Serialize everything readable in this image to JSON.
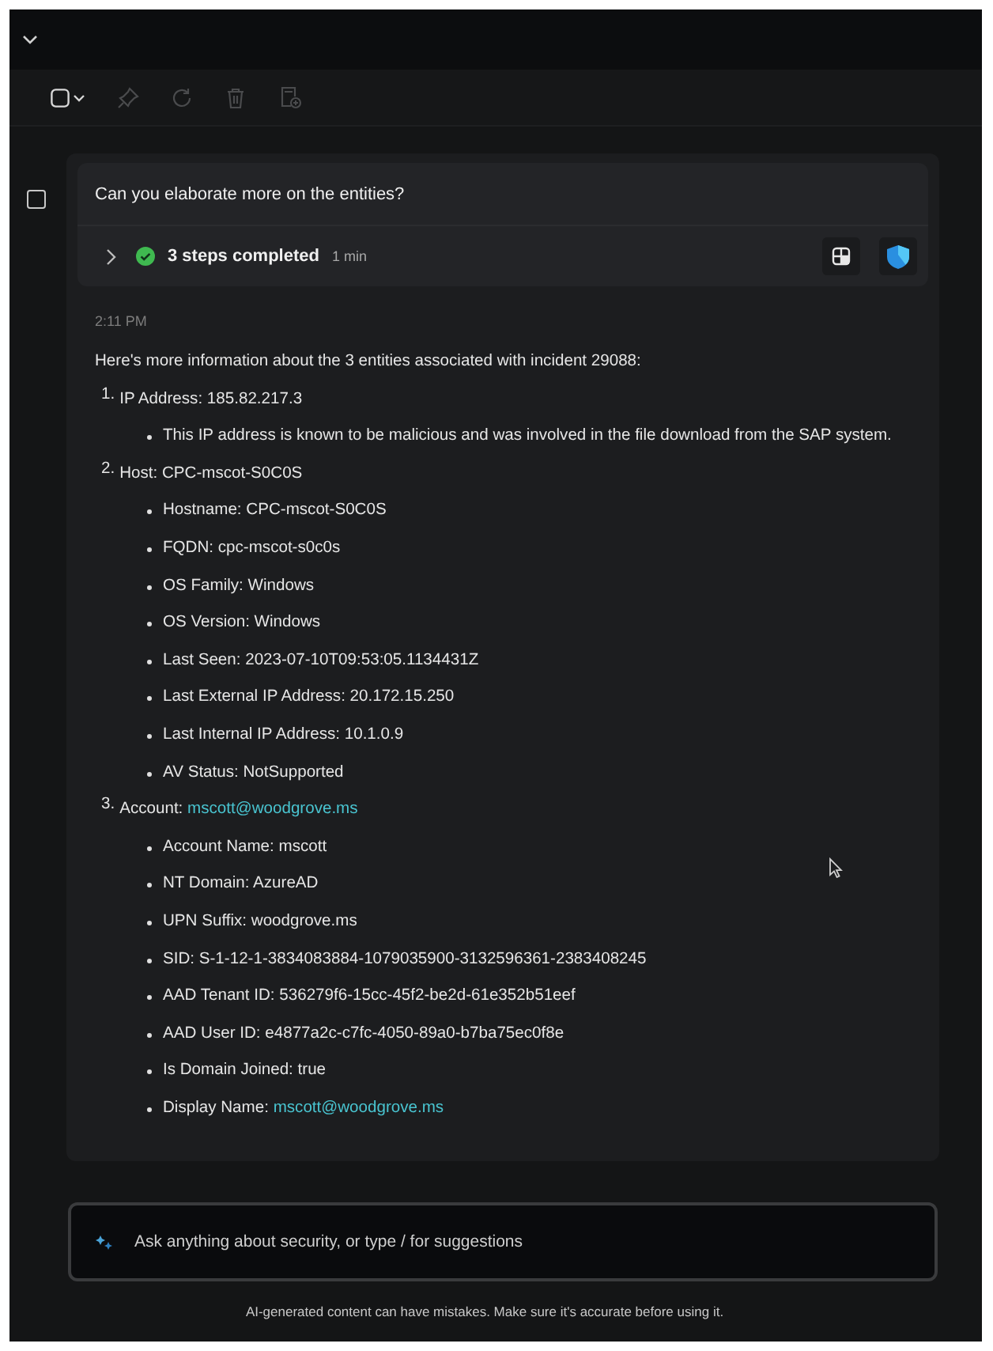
{
  "toolbar": [
    {
      "kind": "select",
      "disabled": false
    },
    {
      "kind": "pin",
      "disabled": true
    },
    {
      "kind": "refresh",
      "disabled": true
    },
    {
      "kind": "delete",
      "disabled": true
    },
    {
      "kind": "add-note",
      "disabled": true
    }
  ],
  "prompt": {
    "selected": false,
    "question": "Can you elaborate more on the entities?",
    "steps": {
      "expanded": false,
      "label": "3 steps completed",
      "duration": "1 min"
    }
  },
  "response": {
    "time": "2:11 PM",
    "intro": "Here's more information about the 3 entities associated with incident 29088:",
    "entities": [
      {
        "number": "1.",
        "label": "IP Address: 185.82.217.3",
        "details": [
          {
            "text": "This IP address is known to be malicious and was involved in the file download from the SAP system."
          }
        ]
      },
      {
        "number": "2.",
        "label": "Host: CPC-mscot-S0C0S",
        "details": [
          {
            "text": "Hostname: CPC-mscot-S0C0S"
          },
          {
            "text": "FQDN: cpc-mscot-s0c0s"
          },
          {
            "text": "OS Family: Windows"
          },
          {
            "text": "OS Version: Windows"
          },
          {
            "text": "Last Seen: 2023-07-10T09:53:05.1134431Z"
          },
          {
            "text": "Last External IP Address: 20.172.15.250"
          },
          {
            "text": "Last Internal IP Address: 10.1.0.9"
          },
          {
            "text": "AV Status: NotSupported"
          }
        ]
      },
      {
        "number": "3.",
        "label": "Account:",
        "link": "mscott@woodgrove.ms",
        "details": [
          {
            "text": "Account Name: mscott"
          },
          {
            "text": "NT Domain: AzureAD"
          },
          {
            "text": "UPN Suffix: woodgrove.ms"
          },
          {
            "text": "SID: S-1-12-1-3834083884-1079035900-3132596361-2383408245"
          },
          {
            "text": "AAD Tenant ID: 536279f6-15cc-45f2-be2d-61e352b51eef"
          },
          {
            "text": "AAD User ID: e4877a2c-c7fc-4050-89a0-b7ba75ec0f8e"
          },
          {
            "text": "Is Domain Joined: true"
          },
          {
            "text": "Display Name:",
            "link": "mscott@woodgrove.ms"
          }
        ]
      }
    ]
  },
  "input": {
    "placeholder": "Ask anything about security, or type / for suggestions"
  },
  "disclaimer": "AI-generated content can have mistakes. Make sure it's accurate before using it."
}
